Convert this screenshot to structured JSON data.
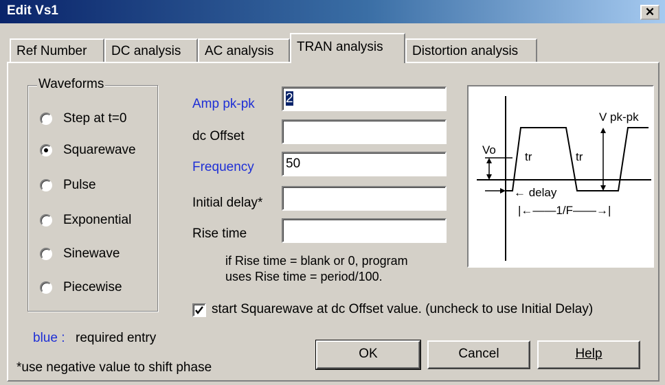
{
  "window": {
    "title": "Edit Vs1",
    "close_glyph": "✕"
  },
  "tabs": [
    {
      "label": "Ref Number"
    },
    {
      "label": "DC analysis"
    },
    {
      "label": "AC analysis"
    },
    {
      "label": "TRAN analysis",
      "active": true
    },
    {
      "label": "Distortion analysis"
    }
  ],
  "waveforms": {
    "title": "Waveforms",
    "selected": "Squarewave",
    "options": [
      {
        "label": "Step at t=0"
      },
      {
        "label": "Squarewave"
      },
      {
        "label": "Pulse"
      },
      {
        "label": "Exponential"
      },
      {
        "label": "Sinewave"
      },
      {
        "label": "Piecewise"
      }
    ]
  },
  "fields": {
    "amp": {
      "label": "Amp pk-pk",
      "value": "2",
      "required": true
    },
    "dc_offset": {
      "label": "dc Offset",
      "value": ""
    },
    "frequency": {
      "label": "Frequency",
      "value": "50",
      "required": true
    },
    "initial_delay": {
      "label": "Initial delay*",
      "value": ""
    },
    "rise_time": {
      "label": "Rise time",
      "value": ""
    }
  },
  "notes": {
    "rise_line1": "if Rise time = blank or 0,  program",
    "rise_line2": "uses Rise time = period/100.",
    "legend_blue": "blue :",
    "legend_text": "required entry",
    "footnote": "*use negative value to shift phase"
  },
  "checkbox": {
    "checked": true,
    "label": "start Squarewave at dc Offset value. (uncheck to use Initial Delay)"
  },
  "diagram": {
    "vo": "Vo",
    "tr1": "tr",
    "tr2": "tr",
    "vpp": "V pk-pk",
    "delay": "← delay",
    "period": "|←——1/F——→|"
  },
  "buttons": {
    "ok": "OK",
    "cancel": "Cancel",
    "help": "Help"
  },
  "colors": {
    "required_label": "#1e2fd6",
    "title_bar": "#0a246a"
  }
}
